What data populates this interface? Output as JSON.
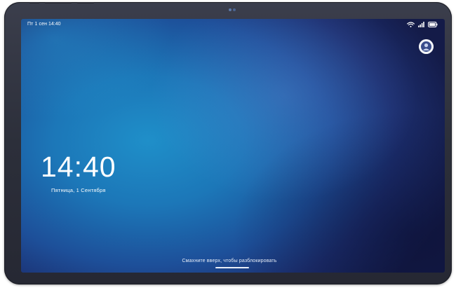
{
  "status_bar": {
    "date": "Пт 1 сен",
    "time": "14:40",
    "icons": [
      "wifi-icon",
      "signal-icon",
      "battery-icon"
    ]
  },
  "lock_screen": {
    "clock": "14:40",
    "date": "Пятница, 1 Сентября",
    "unlock_hint": "Смахните вверх, чтобы разблокировать",
    "avatar_icon": "user-avatar-icon"
  },
  "colors": {
    "wallpaper_primary": "#1f8fc9",
    "wallpaper_dark": "#141b48",
    "bezel": "#2c2f3a",
    "text": "#ffffff"
  }
}
